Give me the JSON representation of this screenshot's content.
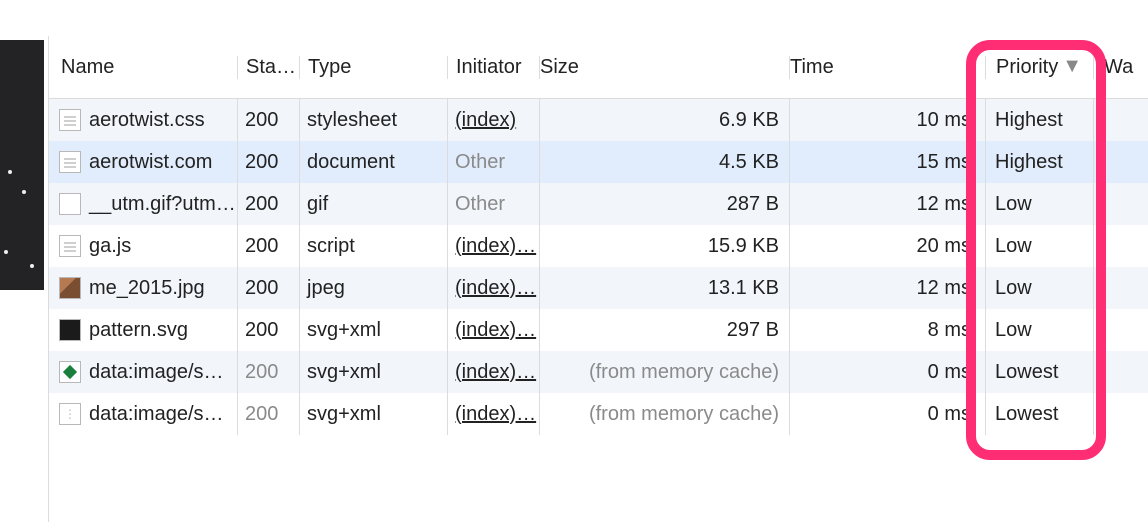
{
  "columns": {
    "name": "Name",
    "status": "Sta…",
    "type": "Type",
    "initiator": "Initiator",
    "size": "Size",
    "time": "Time",
    "priority": "Priority",
    "waterfall": "Wa"
  },
  "sort_indicator": "▼",
  "rows": [
    {
      "icon": "doc",
      "name": "aerotwist.css",
      "status": "200",
      "status_muted": false,
      "type": "stylesheet",
      "initiator": "(index)",
      "initiator_kind": "link",
      "size": "6.9 KB",
      "size_muted": false,
      "time": "10 ms",
      "priority": "Highest",
      "striping": "odd"
    },
    {
      "icon": "doc",
      "name": "aerotwist.com",
      "status": "200",
      "status_muted": false,
      "type": "document",
      "initiator": "Other",
      "initiator_kind": "muted",
      "size": "4.5 KB",
      "size_muted": false,
      "time": "15 ms",
      "priority": "Highest",
      "striping": "sel"
    },
    {
      "icon": "blank",
      "name": "__utm.gif?utm…",
      "status": "200",
      "status_muted": false,
      "type": "gif",
      "initiator": "Other",
      "initiator_kind": "muted",
      "size": "287 B",
      "size_muted": false,
      "time": "12 ms",
      "priority": "Low",
      "striping": "odd"
    },
    {
      "icon": "doc",
      "name": "ga.js",
      "status": "200",
      "status_muted": false,
      "type": "script",
      "initiator": "(index)…",
      "initiator_kind": "link",
      "size": "15.9 KB",
      "size_muted": false,
      "time": "20 ms",
      "priority": "Low",
      "striping": "even"
    },
    {
      "icon": "img",
      "name": "me_2015.jpg",
      "status": "200",
      "status_muted": false,
      "type": "jpeg",
      "initiator": "(index)…",
      "initiator_kind": "link",
      "size": "13.1 KB",
      "size_muted": false,
      "time": "12 ms",
      "priority": "Low",
      "striping": "odd"
    },
    {
      "icon": "dark",
      "name": "pattern.svg",
      "status": "200",
      "status_muted": false,
      "type": "svg+xml",
      "initiator": "(index)…",
      "initiator_kind": "link",
      "size": "297 B",
      "size_muted": false,
      "time": "8 ms",
      "priority": "Low",
      "striping": "even"
    },
    {
      "icon": "diamond",
      "name": "data:image/s…",
      "status": "200",
      "status_muted": true,
      "type": "svg+xml",
      "initiator": "(index)…",
      "initiator_kind": "link",
      "size": "(from memory cache)",
      "size_muted": true,
      "time": "0 ms",
      "priority": "Lowest",
      "striping": "odd"
    },
    {
      "icon": "dots",
      "name": "data:image/s…",
      "status": "200",
      "status_muted": true,
      "type": "svg+xml",
      "initiator": "(index)…",
      "initiator_kind": "link",
      "size": "(from memory cache)",
      "size_muted": true,
      "time": "0 ms",
      "priority": "Lowest",
      "striping": "even"
    }
  ]
}
